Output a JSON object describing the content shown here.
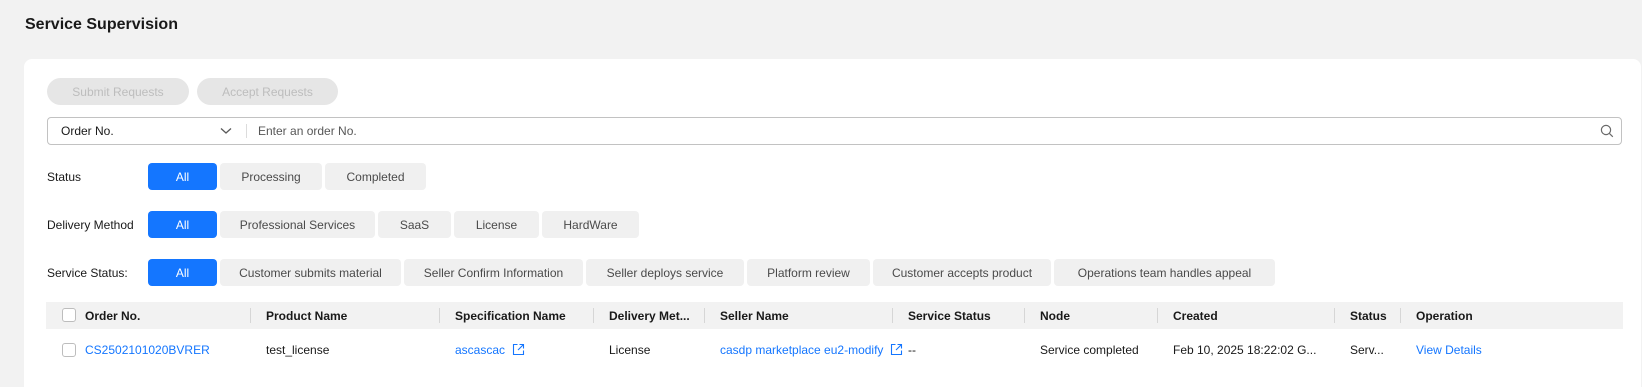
{
  "page": {
    "title": "Service Supervision"
  },
  "toolbar": {
    "submit_label": "Submit Requests",
    "accept_label": "Accept Requests"
  },
  "search": {
    "field_label": "Order No.",
    "placeholder": "Enter an order No."
  },
  "filters": {
    "status": {
      "label": "Status",
      "options": [
        "All",
        "Processing",
        "Completed"
      ],
      "selected": "All"
    },
    "delivery": {
      "label": "Delivery Method",
      "options": [
        "All",
        "Professional Services",
        "SaaS",
        "License",
        "HardWare"
      ],
      "selected": "All"
    },
    "service_status": {
      "label": "Service Status:",
      "options": [
        "All",
        "Customer submits material",
        "Seller Confirm Information",
        "Seller deploys service",
        "Platform review",
        "Customer accepts product",
        "Operations team handles appeal"
      ],
      "selected": "All"
    }
  },
  "table": {
    "columns": [
      "Order No.",
      "Product Name",
      "Specification Name",
      "Delivery Met...",
      "Seller Name",
      "Service Status",
      "Node",
      "Created",
      "Status",
      "Operation"
    ],
    "rows": [
      {
        "order_no": "CS2502101020BVRER",
        "product_name": "test_license",
        "spec_name": "ascascac",
        "delivery": "License",
        "seller": "casdp marketplace eu2-modify",
        "service_status": "--",
        "node": "Service completed",
        "created": "Feb 10, 2025 18:22:02 G...",
        "status": "Serv...",
        "operation": "View Details"
      }
    ]
  },
  "colors": {
    "primary": "#1476ff",
    "page_bg": "#f2f2f2"
  }
}
